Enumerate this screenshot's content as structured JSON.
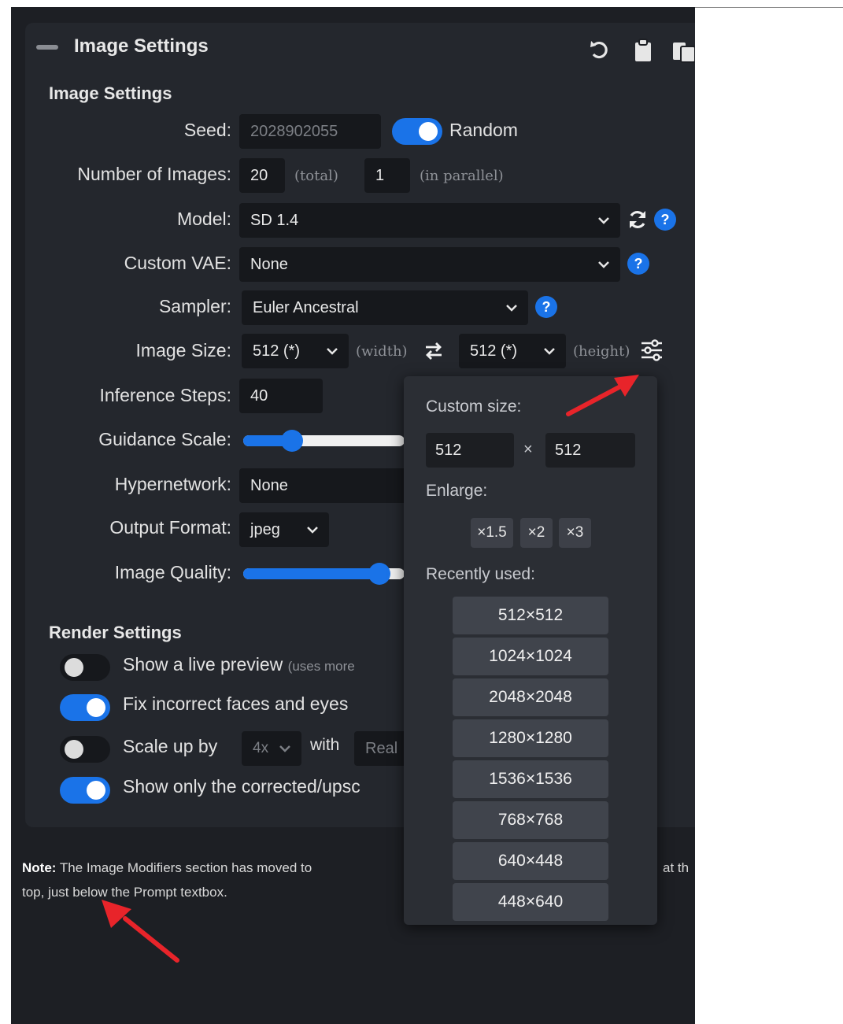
{
  "panel": {
    "title": "Image Settings",
    "icons": [
      "reset-icon",
      "clipboard-icon",
      "paste-icon"
    ]
  },
  "image_settings": {
    "title": "Image Settings",
    "seed": {
      "label": "Seed:",
      "value": "2028902055",
      "random_label": "Random",
      "random_on": true
    },
    "num_images": {
      "label": "Number of Images:",
      "total": "20",
      "total_hint": "(total)",
      "parallel": "1",
      "parallel_hint": "(in parallel)"
    },
    "model": {
      "label": "Model:",
      "value": "SD 1.4"
    },
    "vae": {
      "label": "Custom VAE:",
      "value": "None"
    },
    "sampler": {
      "label": "Sampler:",
      "value": "Euler Ancestral"
    },
    "image_size": {
      "label": "Image Size:",
      "width": "512 (*)",
      "width_hint": "(width)",
      "height": "512 (*)",
      "height_hint": "(height)"
    },
    "steps": {
      "label": "Inference Steps:",
      "value": "40"
    },
    "guidance": {
      "label": "Guidance Scale:",
      "level": 0.27
    },
    "hypernetwork": {
      "label": "Hypernetwork:",
      "value": "None"
    },
    "output_format": {
      "label": "Output Format:",
      "value": "jpeg"
    },
    "quality": {
      "label": "Image Quality:",
      "level": 0.9
    },
    "help_glyph": "?"
  },
  "render_settings": {
    "title": "Render Settings",
    "live_preview": {
      "label": "Show a live preview",
      "hint": "(uses more",
      "on": false
    },
    "fix_faces": {
      "label": "Fix incorrect faces and eyes",
      "on": true
    },
    "upscale": {
      "label_before": "Scale up by",
      "factor": "4x",
      "label_with": "with",
      "model": "Real",
      "on": false
    },
    "show_corrected": {
      "label": "Show only the corrected/upsc",
      "on": true
    }
  },
  "note": {
    "bold": "Note:",
    "text_line1": "The Image Modifiers section has moved to",
    "text_after": "at th",
    "text_line2": "top, just below the Prompt textbox."
  },
  "size_popup": {
    "custom_label": "Custom size:",
    "custom_width": "512",
    "custom_times": "×",
    "custom_height": "512",
    "enlarge_label": "Enlarge:",
    "enlarge": [
      "×1.5",
      "×2",
      "×3"
    ],
    "recent_label": "Recently used:",
    "recent": [
      "512×512",
      "1024×1024",
      "2048×2048",
      "1280×1280",
      "1536×1536",
      "768×768",
      "640×448",
      "448×640"
    ]
  },
  "colors": {
    "accent": "#1a73e8",
    "background": "#1d1f24",
    "panel": "#24272d",
    "annotation_arrow": "#e8242a"
  }
}
